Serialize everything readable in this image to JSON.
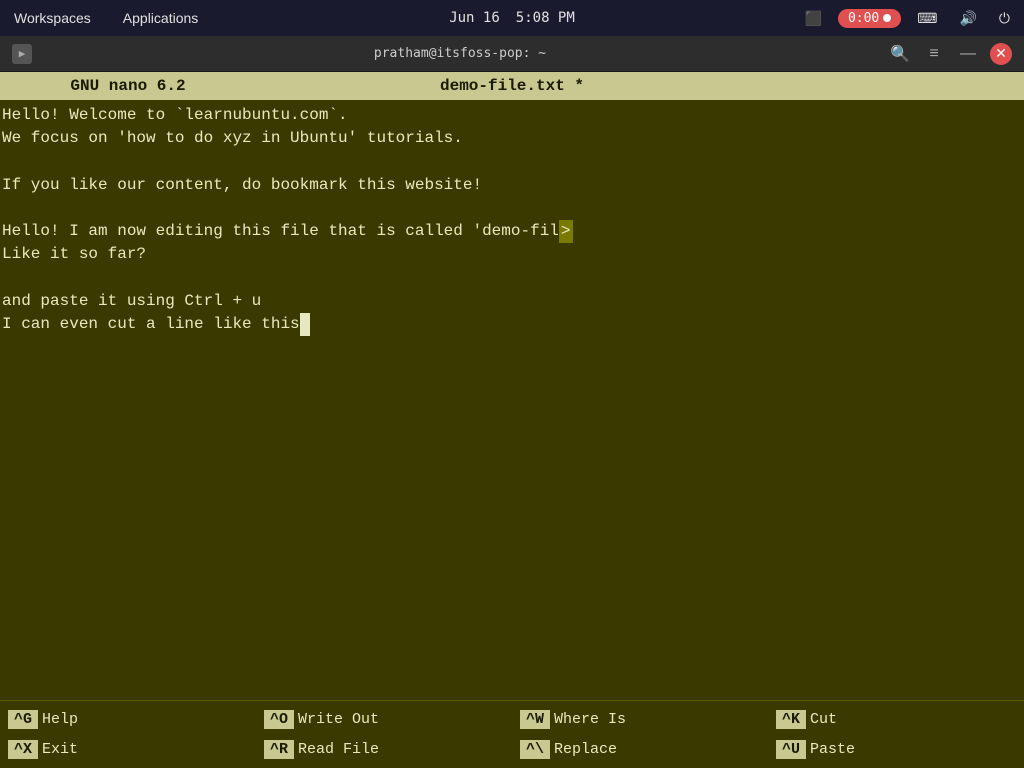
{
  "topbar": {
    "workspaces_label": "Workspaces",
    "applications_label": "Applications",
    "date": "Jun 16",
    "time": "5:08 PM",
    "record_label": "0:00",
    "icons": {
      "screen": "⬛",
      "keyboard": "⌨",
      "sound": "🔊",
      "power": "⏻"
    }
  },
  "terminal": {
    "title": "pratham@itsfoss-pop: ~",
    "tab_icon": "▶",
    "search_icon": "🔍",
    "menu_icon": "≡",
    "minimize_icon": "—",
    "close_icon": "✕"
  },
  "nano": {
    "header_left": "GNU nano 6.2",
    "header_center": "demo-file.txt *",
    "content_lines": [
      "Hello! Welcome to `learnubuntu.com`.",
      "We focus on 'how to do xyz in Ubuntu' tutorials.",
      "",
      "If you like our content, do bookmark this website!",
      "",
      "Hello! I am now editing this file that is called 'demo-fil",
      "Like it so far?",
      "",
      "and paste it using Ctrl + u",
      "I can even cut a line like this"
    ],
    "overflow_char": ">",
    "cursor_char": " ",
    "shortcuts": [
      {
        "key": "^G",
        "label": "Help"
      },
      {
        "key": "^O",
        "label": "Write Out"
      },
      {
        "key": "^W",
        "label": "Where Is"
      },
      {
        "key": "^K",
        "label": "Cut"
      },
      {
        "key": "^X",
        "label": "Exit"
      },
      {
        "key": "^R",
        "label": "Read File"
      },
      {
        "key": "^\\",
        "label": "Replace"
      },
      {
        "key": "^U",
        "label": "Paste"
      }
    ]
  }
}
